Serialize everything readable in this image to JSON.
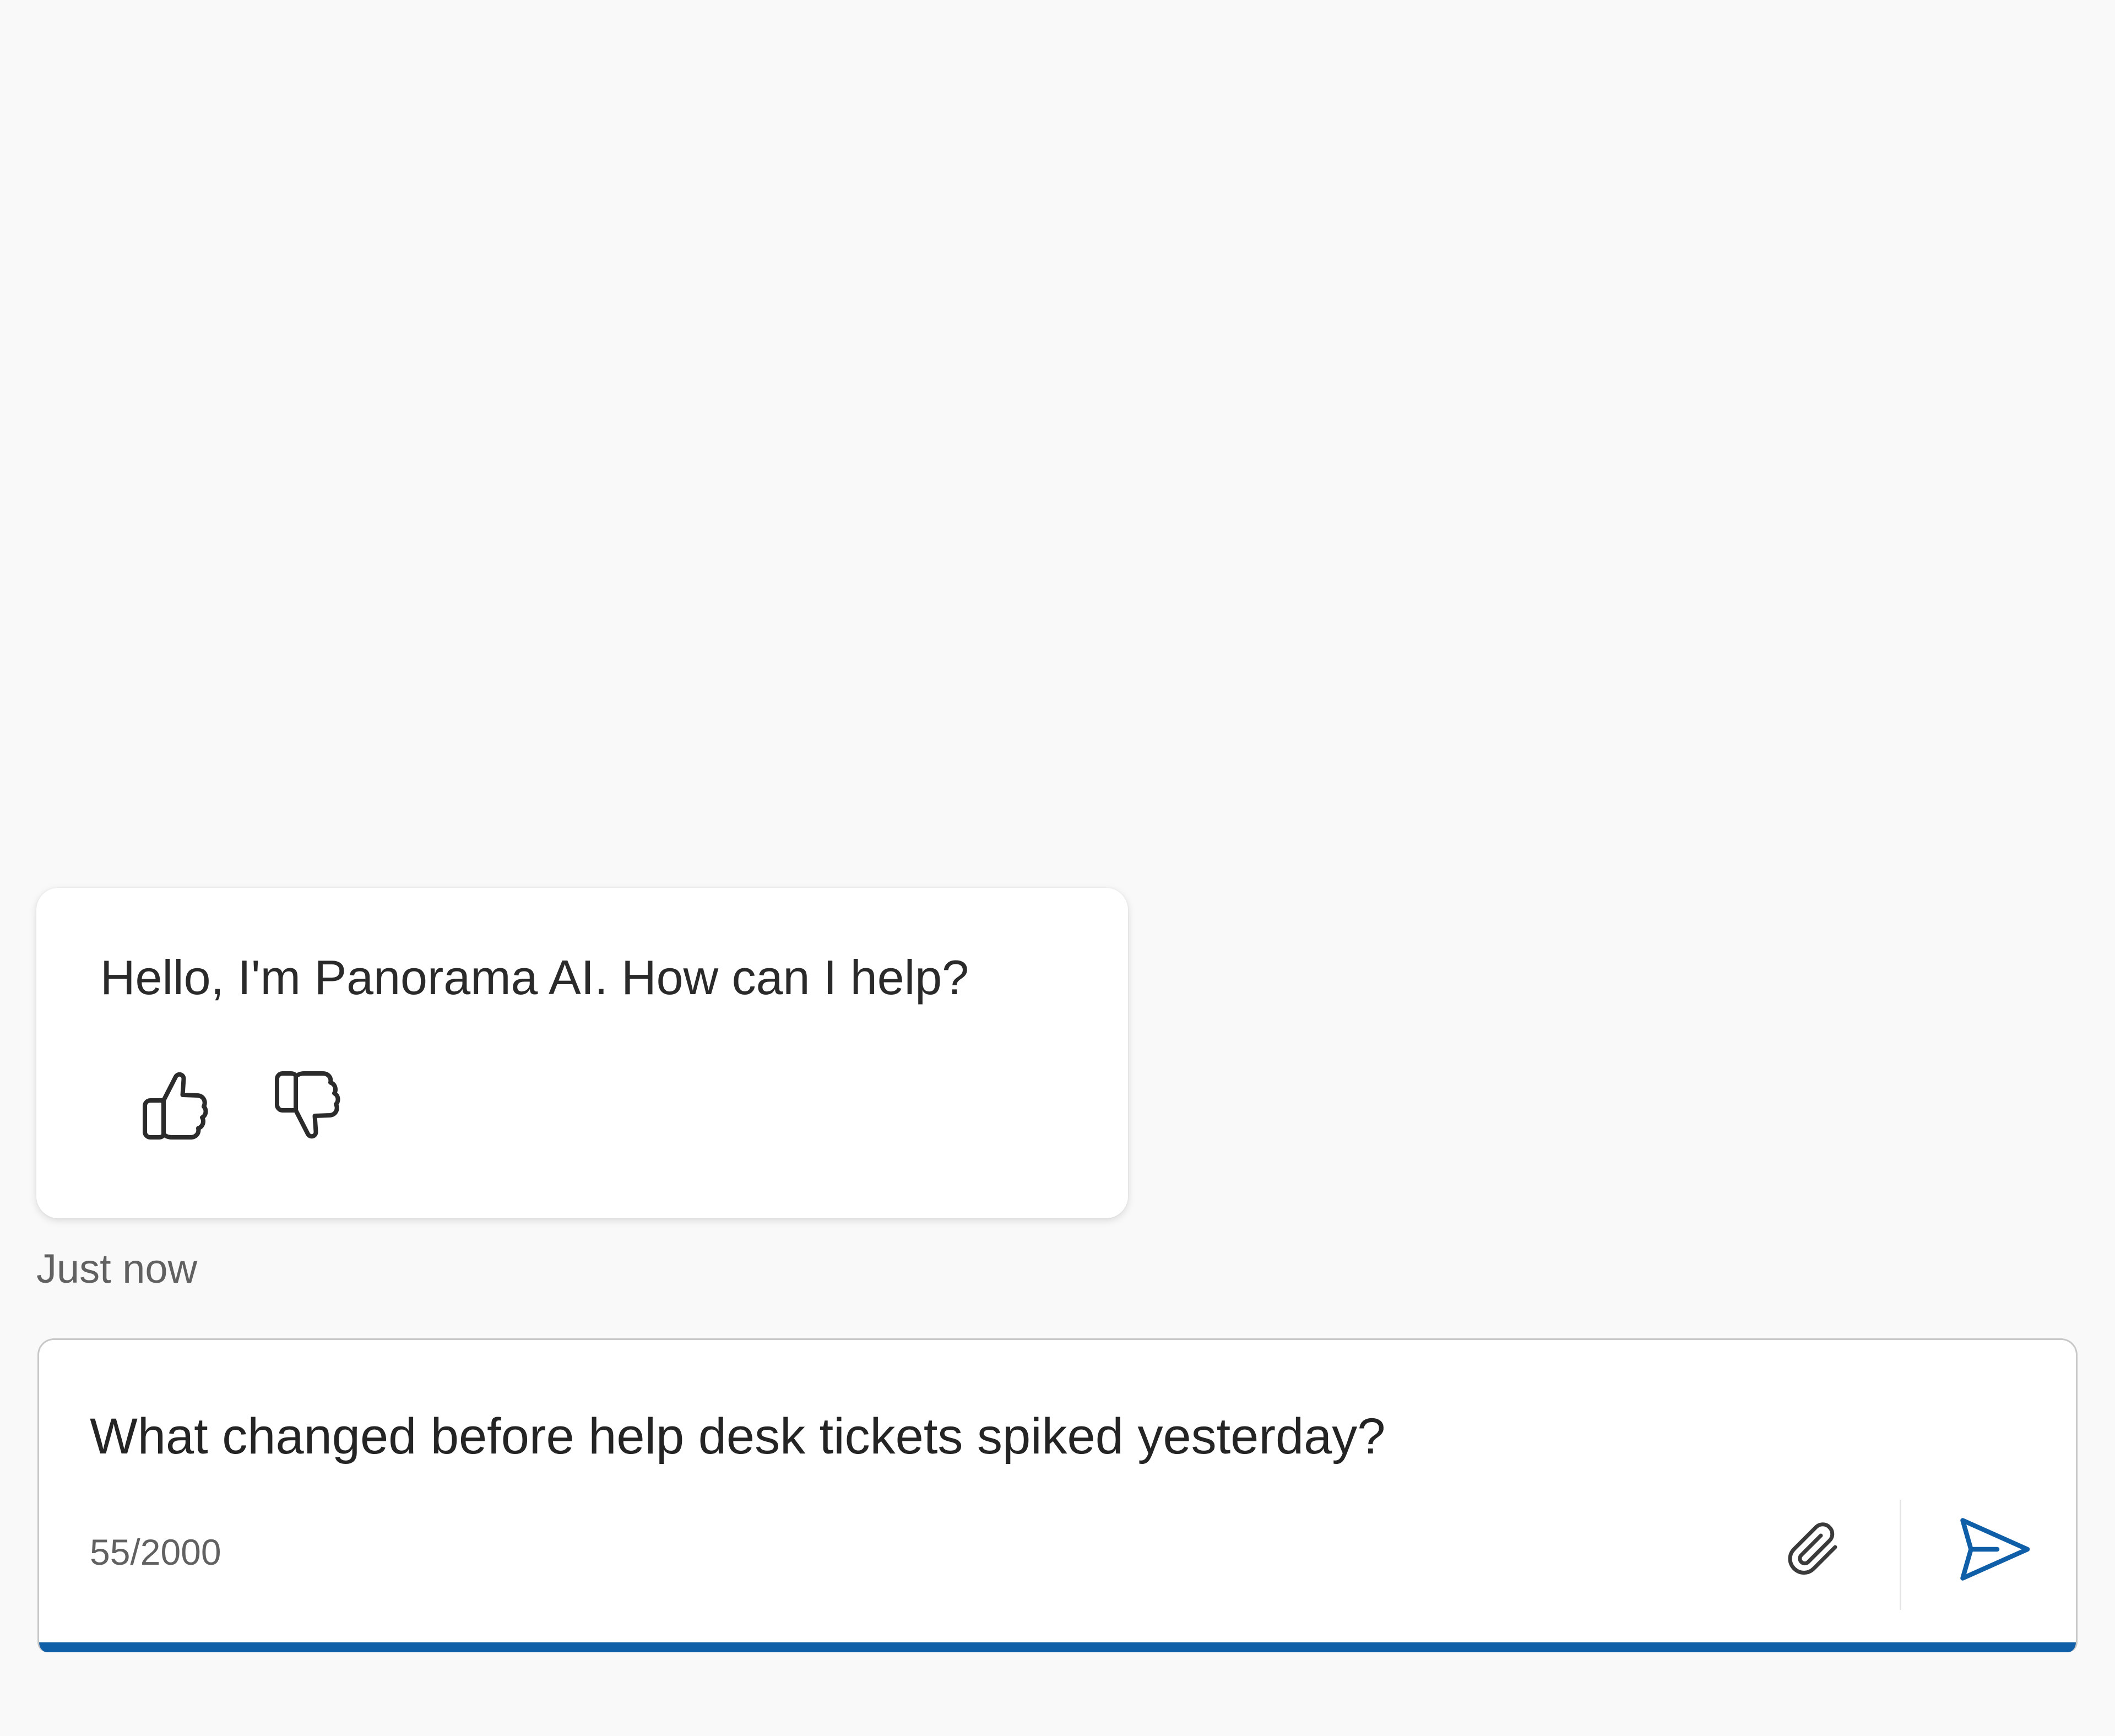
{
  "conversation": {
    "bot_message": "Hello, I'm Panorama AI. How can I help?",
    "timestamp": "Just now",
    "feedback": {
      "like_icon": "thumbs-up-icon",
      "dislike_icon": "thumbs-down-icon"
    }
  },
  "composer": {
    "input_value": "What changed before help desk tickets spiked yesterday?",
    "char_count": "55/2000",
    "attach_icon": "paperclip-icon",
    "send_icon": "send-icon",
    "accent_color": "#0f5ea8"
  }
}
